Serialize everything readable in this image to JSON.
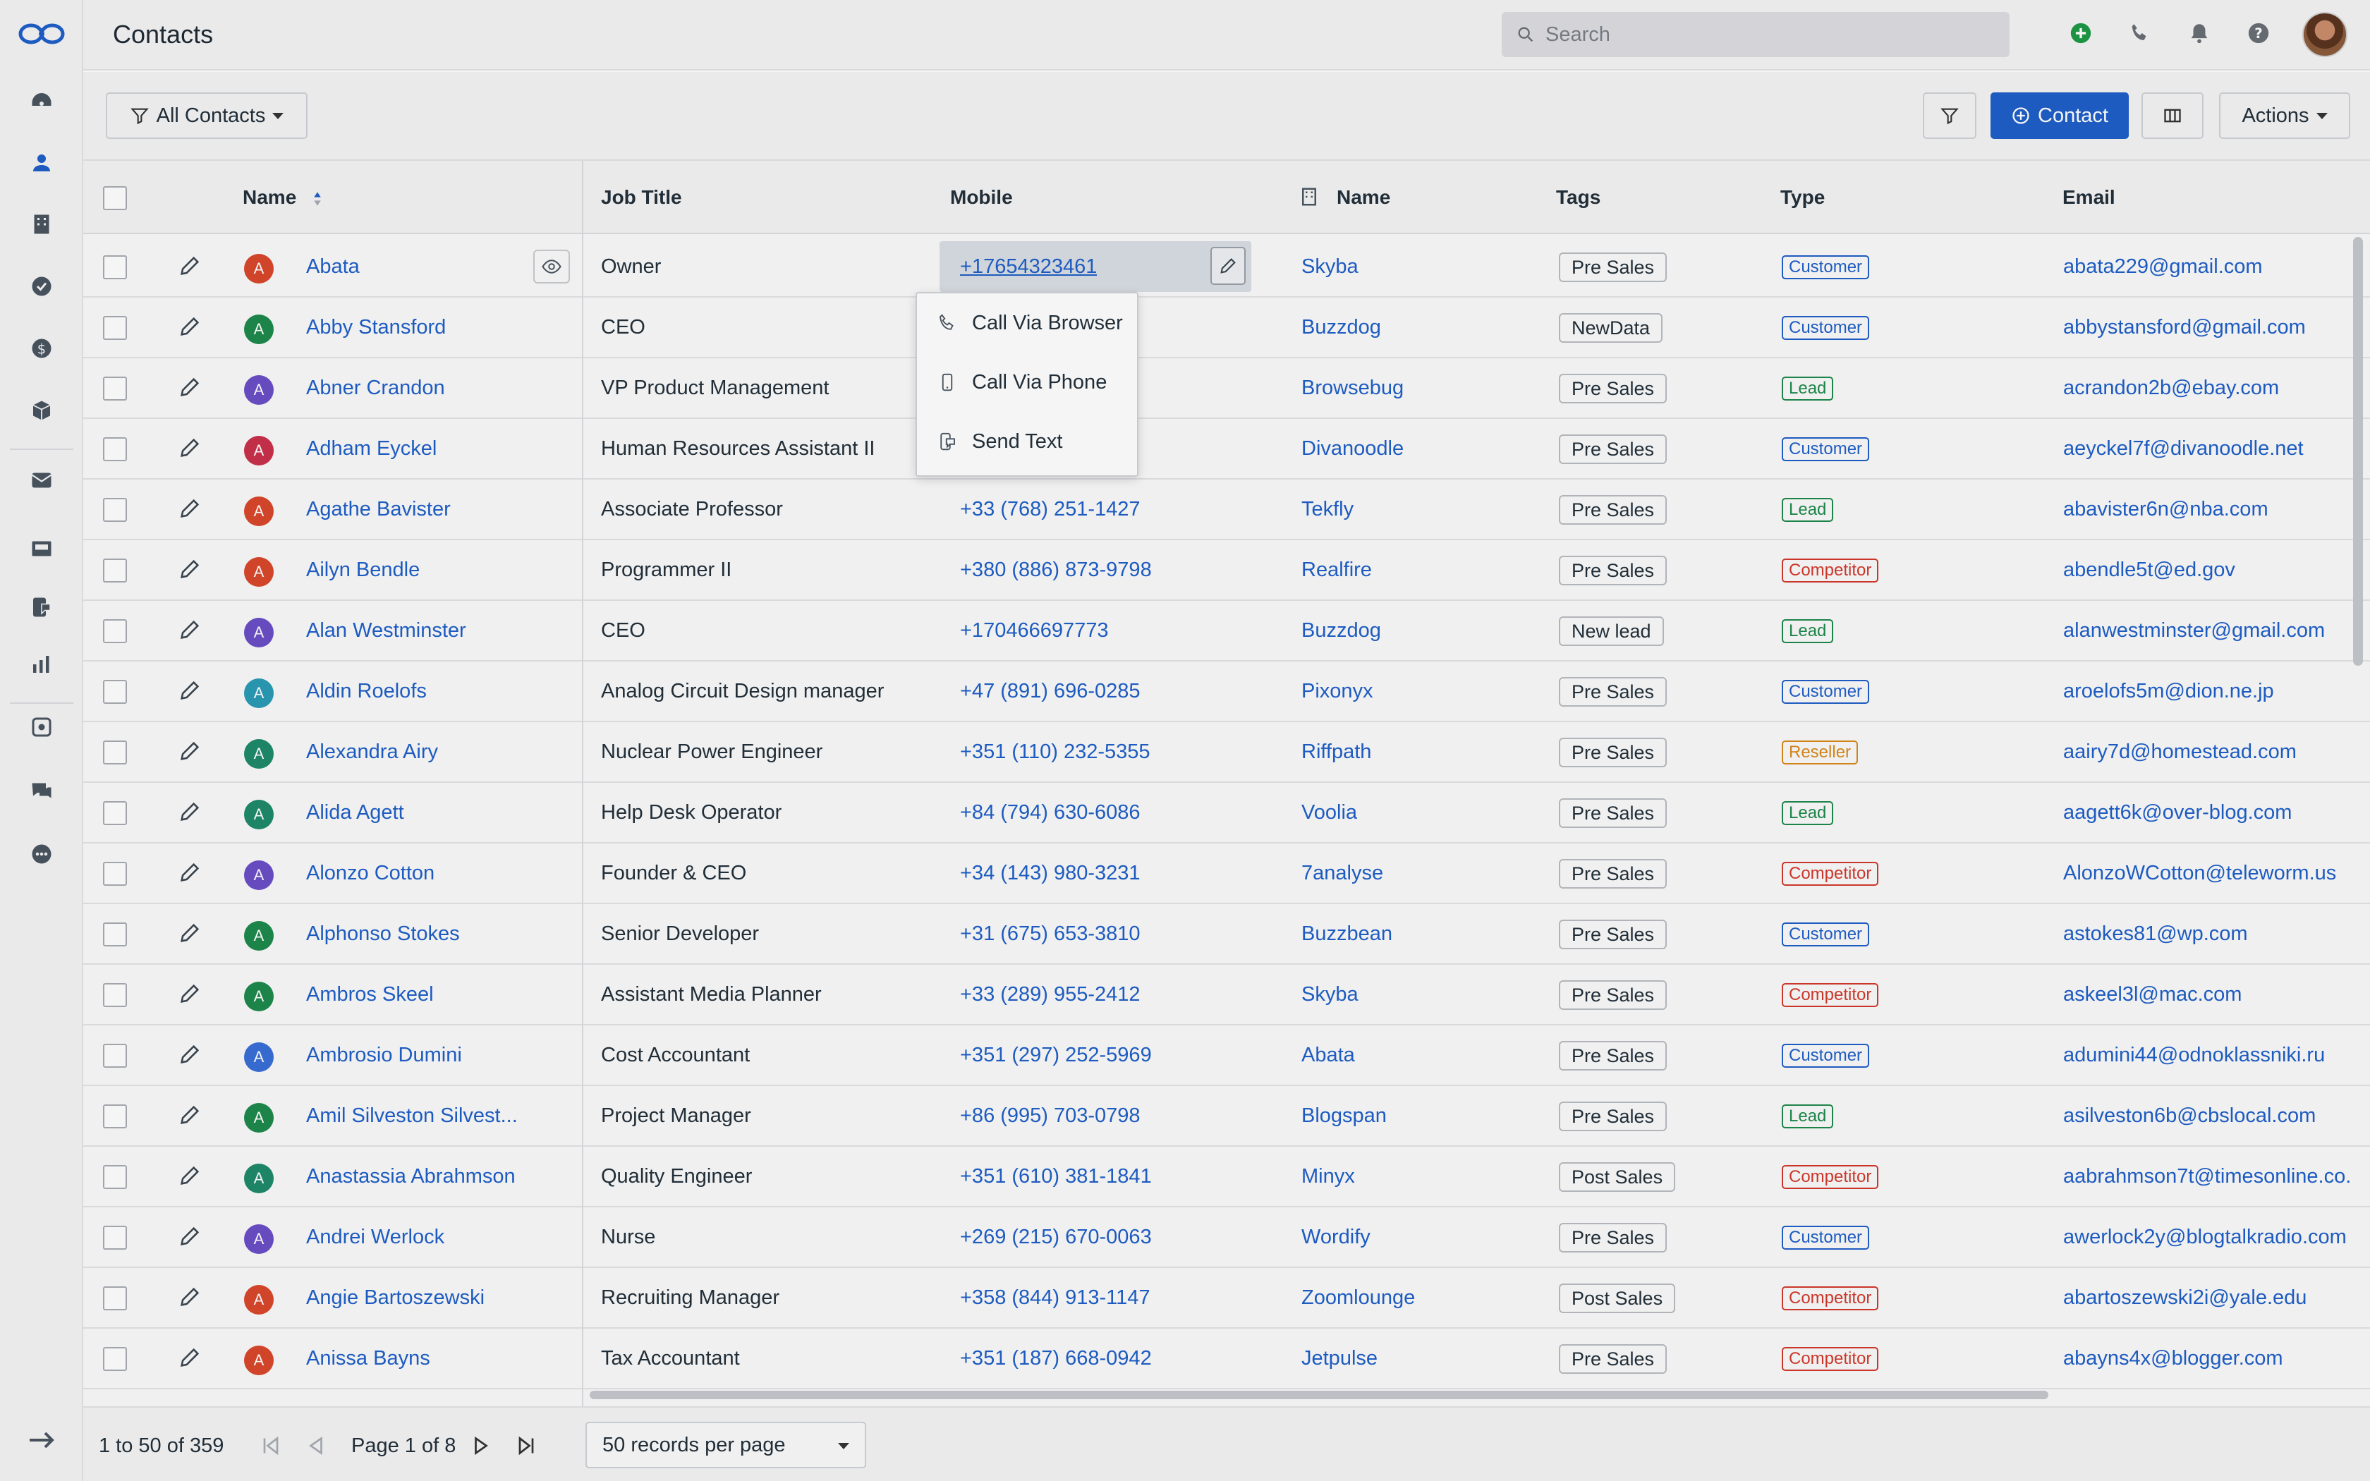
{
  "header": {
    "title": "Contacts",
    "search_placeholder": "Search",
    "icons": [
      "add-icon",
      "phone-icon",
      "bell-icon",
      "help-icon"
    ]
  },
  "toolbar": {
    "filter_view_label": "All Contacts",
    "add_contact_label": "Contact",
    "actions_label": "Actions"
  },
  "table": {
    "columns": [
      "Name",
      "Job Title",
      "Mobile",
      "Name",
      "Tags",
      "Type",
      "Email"
    ],
    "rows": [
      {
        "initial": "A",
        "color": "#d9472b",
        "name": "Abata",
        "job": "Owner",
        "mobile": "+17654323461",
        "company": "Skyba",
        "tag": "Pre Sales",
        "type": "Customer",
        "email": "abata229@gmail.com"
      },
      {
        "initial": "A",
        "color": "#1f8a4c",
        "name": "Abby Stansford",
        "job": "CEO",
        "mobile": "",
        "company": "Buzzdog",
        "tag": "NewData",
        "type": "Customer",
        "email": "abbystansford@gmail.com"
      },
      {
        "initial": "A",
        "color": "#6b4fc7",
        "name": "Abner Crandon",
        "job": "VP Product Management",
        "mobile": "",
        "company": "Browsebug",
        "tag": "Pre Sales",
        "type": "Lead",
        "email": "acrandon2b@ebay.com"
      },
      {
        "initial": "A",
        "color": "#c9304a",
        "name": "Adham Eyckel",
        "job": "Human Resources Assistant II",
        "mobile": "",
        "company": "Divanoodle",
        "tag": "Pre Sales",
        "type": "Customer",
        "email": "aeyckel7f@divanoodle.net"
      },
      {
        "initial": "A",
        "color": "#d9472b",
        "name": "Agathe Bavister",
        "job": "Associate Professor",
        "mobile": "+33 (768) 251-1427",
        "company": "Tekfly",
        "tag": "Pre Sales",
        "type": "Lead",
        "email": "abavister6n@nba.com"
      },
      {
        "initial": "A",
        "color": "#d9472b",
        "name": "Ailyn Bendle",
        "job": "Programmer II",
        "mobile": "+380 (886) 873-9798",
        "company": "Realfire",
        "tag": "Pre Sales",
        "type": "Competitor",
        "email": "abendle5t@ed.gov"
      },
      {
        "initial": "A",
        "color": "#6b4fc7",
        "name": "Alan Westminster",
        "job": "CEO",
        "mobile": "+170466697773",
        "company": "Buzzdog",
        "tag": "New lead",
        "type": "Lead",
        "email": "alanwestminster@gmail.com"
      },
      {
        "initial": "A",
        "color": "#2a9bb5",
        "name": "Aldin Roelofs",
        "job": "Analog Circuit Design manager",
        "mobile": "+47 (891) 696-0285",
        "company": "Pixonyx",
        "tag": "Pre Sales",
        "type": "Customer",
        "email": "aroelofs5m@dion.ne.jp"
      },
      {
        "initial": "A",
        "color": "#1f8a6a",
        "name": "Alexandra Airy",
        "job": "Nuclear Power Engineer",
        "mobile": "+351 (110) 232-5355",
        "company": "Riffpath",
        "tag": "Pre Sales",
        "type": "Reseller",
        "email": "aairy7d@homestead.com"
      },
      {
        "initial": "A",
        "color": "#1f8a6a",
        "name": "Alida Agett",
        "job": "Help Desk Operator",
        "mobile": "+84 (794) 630-6086",
        "company": "Voolia",
        "tag": "Pre Sales",
        "type": "Lead",
        "email": "aagett6k@over-blog.com"
      },
      {
        "initial": "A",
        "color": "#6b4fc7",
        "name": "Alonzo Cotton",
        "job": "Founder & CEO",
        "mobile": "+34 (143) 980-3231",
        "company": "7analyse",
        "tag": "Pre Sales",
        "type": "Competitor",
        "email": "AlonzoWCotton@teleworm.us"
      },
      {
        "initial": "A",
        "color": "#1f8a4c",
        "name": "Alphonso Stokes",
        "job": "Senior Developer",
        "mobile": "+31 (675) 653-3810",
        "company": "Buzzbean",
        "tag": "Pre Sales",
        "type": "Customer",
        "email": "astokes81@wp.com"
      },
      {
        "initial": "A",
        "color": "#1f8a4c",
        "name": "Ambros Skeel",
        "job": "Assistant Media Planner",
        "mobile": "+33 (289) 955-2412",
        "company": "Skyba",
        "tag": "Pre Sales",
        "type": "Competitor",
        "email": "askeel3l@mac.com"
      },
      {
        "initial": "A",
        "color": "#3a6fd8",
        "name": "Ambrosio Dumini",
        "job": "Cost Accountant",
        "mobile": "+351 (297) 252-5969",
        "company": "Abata",
        "tag": "Pre Sales",
        "type": "Customer",
        "email": "adumini44@odnoklassniki.ru"
      },
      {
        "initial": "A",
        "color": "#1f8a4c",
        "name": "Amil Silveston Silvest...",
        "job": "Project Manager",
        "mobile": "+86 (995) 703-0798",
        "company": "Blogspan",
        "tag": "Pre Sales",
        "type": "Lead",
        "email": "asilveston6b@cbslocal.com"
      },
      {
        "initial": "A",
        "color": "#1f8a6a",
        "name": "Anastassia Abrahmson",
        "job": "Quality Engineer",
        "mobile": "+351 (610) 381-1841",
        "company": "Minyx",
        "tag": "Post Sales",
        "type": "Competitor",
        "email": "aabrahmson7t@timesonline.co."
      },
      {
        "initial": "A",
        "color": "#6b4fc7",
        "name": "Andrei Werlock",
        "job": "Nurse",
        "mobile": "+269 (215) 670-0063",
        "company": "Wordify",
        "tag": "Pre Sales",
        "type": "Customer",
        "email": "awerlock2y@blogtalkradio.com"
      },
      {
        "initial": "A",
        "color": "#d9472b",
        "name": "Angie Bartoszewski",
        "job": "Recruiting Manager",
        "mobile": "+358 (844) 913-1147",
        "company": "Zoomlounge",
        "tag": "Post Sales",
        "type": "Competitor",
        "email": "abartoszewski2i@yale.edu"
      },
      {
        "initial": "A",
        "color": "#d9472b",
        "name": "Anissa Bayns",
        "job": "Tax Accountant",
        "mobile": "+351 (187) 668-0942",
        "company": "Jetpulse",
        "tag": "Pre Sales",
        "type": "Competitor",
        "email": "abayns4x@blogger.com"
      }
    ]
  },
  "type_colors": {
    "Customer": "#1f5fc8",
    "Lead": "#1f8a4c",
    "Competitor": "#d33a2c",
    "Reseller": "#d98a1c"
  },
  "menu": {
    "items": [
      {
        "label": "Call Via Browser",
        "icon": "phone-icon"
      },
      {
        "label": "Call Via Phone",
        "icon": "mobile-icon"
      },
      {
        "label": "Send Text",
        "icon": "sms-icon"
      }
    ]
  },
  "footer": {
    "range_text": "1 to 50 of 359",
    "page_text": "Page 1 of 8",
    "per_page": "50 records per page"
  }
}
